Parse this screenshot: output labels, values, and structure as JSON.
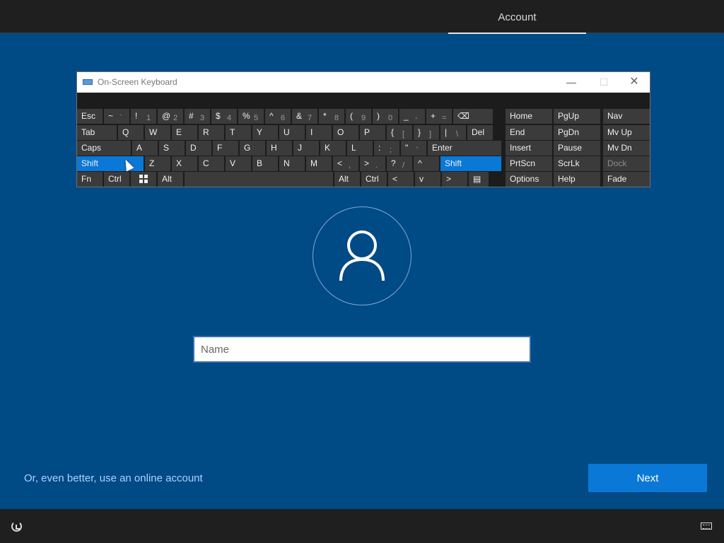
{
  "header": {
    "tab_label": "Account"
  },
  "osk": {
    "title": "On-Screen Keyboard",
    "controls": {
      "minimize": "—",
      "maximize": "☐",
      "close": "✕"
    },
    "rows": [
      [
        {
          "label": "Esc"
        },
        {
          "label": "~",
          "sub": "`"
        },
        {
          "label": "!",
          "sub": "1"
        },
        {
          "label": "@",
          "sub": "2"
        },
        {
          "label": "#",
          "sub": "3"
        },
        {
          "label": "$",
          "sub": "4"
        },
        {
          "label": "%",
          "sub": "5"
        },
        {
          "label": "^",
          "sub": "6"
        },
        {
          "label": "&",
          "sub": "7"
        },
        {
          "label": "*",
          "sub": "8"
        },
        {
          "label": "(",
          "sub": "9"
        },
        {
          "label": ")",
          "sub": "0"
        },
        {
          "label": "_",
          "sub": "-"
        },
        {
          "label": "+",
          "sub": "="
        },
        {
          "label": "⌫"
        }
      ],
      [
        {
          "label": "Tab"
        },
        {
          "label": "Q"
        },
        {
          "label": "W"
        },
        {
          "label": "E"
        },
        {
          "label": "R"
        },
        {
          "label": "T"
        },
        {
          "label": "Y"
        },
        {
          "label": "U"
        },
        {
          "label": "I"
        },
        {
          "label": "O"
        },
        {
          "label": "P"
        },
        {
          "label": "{",
          "sub": "["
        },
        {
          "label": "}",
          "sub": "]"
        },
        {
          "label": "|",
          "sub": "\\"
        },
        {
          "label": "Del"
        }
      ],
      [
        {
          "label": "Caps"
        },
        {
          "label": "A"
        },
        {
          "label": "S"
        },
        {
          "label": "D"
        },
        {
          "label": "F"
        },
        {
          "label": "G"
        },
        {
          "label": "H"
        },
        {
          "label": "J"
        },
        {
          "label": "K"
        },
        {
          "label": "L"
        },
        {
          "label": ":",
          "sub": ";"
        },
        {
          "label": "\"",
          "sub": "'"
        },
        {
          "label": "Enter"
        }
      ],
      [
        {
          "label": "Shift",
          "active": true
        },
        {
          "label": "Z"
        },
        {
          "label": "X"
        },
        {
          "label": "C"
        },
        {
          "label": "V"
        },
        {
          "label": "B"
        },
        {
          "label": "N"
        },
        {
          "label": "M"
        },
        {
          "label": "<",
          "sub": ","
        },
        {
          "label": ">",
          "sub": "."
        },
        {
          "label": "?",
          "sub": "/"
        },
        {
          "label": "^"
        },
        {
          "label": "Shift",
          "active": true
        }
      ],
      [
        {
          "label": "Fn"
        },
        {
          "label": "Ctrl"
        },
        {
          "label": "win-logo-icon"
        },
        {
          "label": "Alt"
        },
        {
          "label": ""
        },
        {
          "label": "Alt"
        },
        {
          "label": "Ctrl"
        },
        {
          "label": "<"
        },
        {
          "label": "v"
        },
        {
          "label": ">"
        },
        {
          "label": "▤"
        }
      ]
    ],
    "nav_rows": [
      [
        {
          "label": "Home"
        },
        {
          "label": "PgUp"
        },
        {
          "label": "Nav"
        }
      ],
      [
        {
          "label": "End"
        },
        {
          "label": "PgDn"
        },
        {
          "label": "Mv Up"
        }
      ],
      [
        {
          "label": "Insert"
        },
        {
          "label": "Pause"
        },
        {
          "label": "Mv Dn"
        }
      ],
      [
        {
          "label": "PrtScn"
        },
        {
          "label": "ScrLk"
        },
        {
          "label": "Dock",
          "dim": true
        }
      ],
      [
        {
          "label": "Options"
        },
        {
          "label": "Help"
        },
        {
          "label": "Fade"
        }
      ]
    ]
  },
  "form": {
    "name_placeholder": "Name",
    "name_value": ""
  },
  "footer": {
    "online_account_link": "Or, even better, use an online account",
    "next_label": "Next"
  },
  "colors": {
    "background": "#004a85",
    "accent": "#0a78d7",
    "bar": "#1f1f1f",
    "link": "#a9d2ff"
  }
}
